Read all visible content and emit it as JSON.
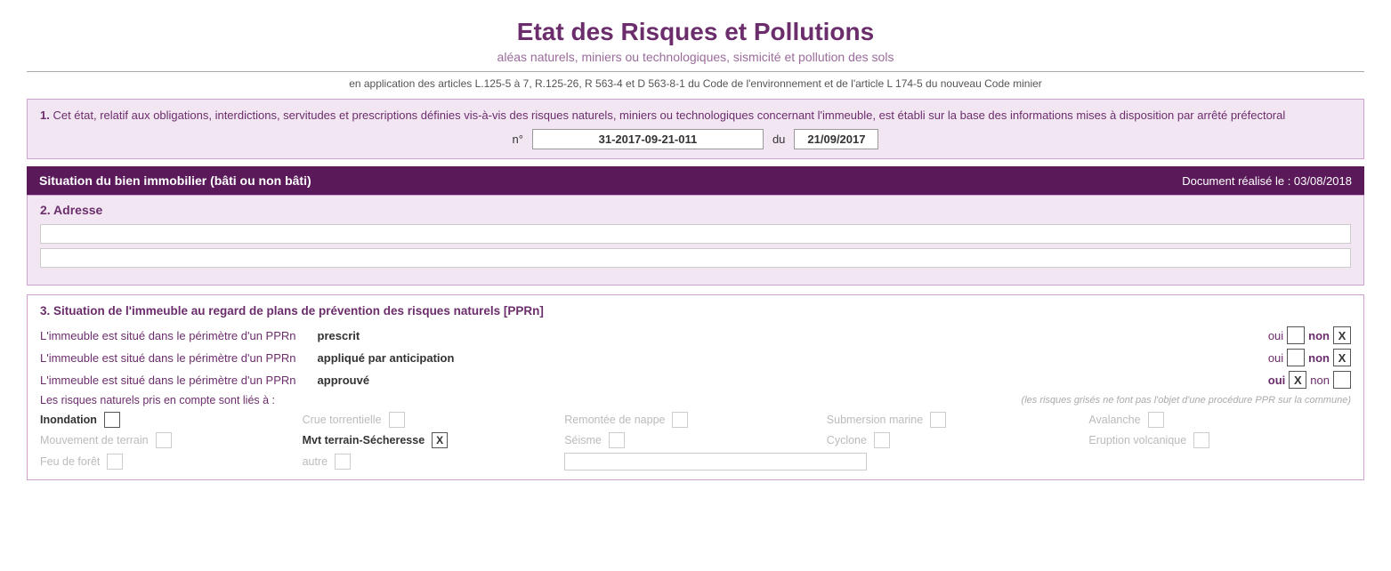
{
  "header": {
    "title": "Etat des Risques et Pollutions",
    "subtitle": "aléas naturels, miniers ou technologiques, sismicité et pollution des sols",
    "legal": "en application des articles L.125-5 à 7, R.125-26, R 563-4 et D 563-8-1 du Code de l'environnement et de l'article L 174-5 du nouveau Code minier"
  },
  "section1": {
    "label": "1.",
    "text": "Cet état, relatif aux obligations, interdictions, servitudes et prescriptions définies vis-à-vis des risques naturels, miniers ou technologiques concernant l'immeuble, est établi sur la base des informations mises à disposition par arrêté préfectoral",
    "numero_label": "n°",
    "numero_value": "31-2017-09-21-011",
    "du_label": "du",
    "date_value": "21/09/2017"
  },
  "situation_header": {
    "title": "Situation du bien immobilier (bâti ou non bâti)",
    "document_date_label": "Document réalisé le : 03/08/2018"
  },
  "section2": {
    "label": "2. Adresse"
  },
  "section3": {
    "title": "3. Situation de l'immeuble au regard de plans de prévention des risques naturels [PPRn]",
    "rows": [
      {
        "label": "L'immeuble est situé dans le périmètre d'un PPRn",
        "type": "prescrit",
        "oui": "",
        "non": "X"
      },
      {
        "label": "L'immeuble est situé dans le périmètre d'un PPRn",
        "type": "appliqué par anticipation",
        "oui": "",
        "non": "X"
      },
      {
        "label": "L'immeuble est situé dans le périmètre d'un PPRn",
        "type": "approuvé",
        "oui": "X",
        "non": ""
      }
    ],
    "risques_label": "Les risques naturels pris en compte sont liés à :",
    "risques_note": "(les risques grisés ne font pas l'objet d'une procédure PPR sur la commune)",
    "risques": [
      {
        "name": "Inondation",
        "checked": "",
        "greyed": false,
        "bold": false
      },
      {
        "name": "Crue torrentielle",
        "checked": "",
        "greyed": true,
        "bold": false
      },
      {
        "name": "Remontée de nappe",
        "checked": "",
        "greyed": true,
        "bold": false
      },
      {
        "name": "Submersion marine",
        "checked": "",
        "greyed": true,
        "bold": false
      },
      {
        "name": "Avalanche",
        "checked": "",
        "greyed": true,
        "bold": false
      },
      {
        "name": "Mouvement de terrain",
        "checked": "",
        "greyed": true,
        "bold": false
      },
      {
        "name": "Mvt terrain-Sécheresse",
        "checked": "X",
        "greyed": false,
        "bold": true
      },
      {
        "name": "Séisme",
        "checked": "",
        "greyed": true,
        "bold": false
      },
      {
        "name": "Cyclone",
        "checked": "",
        "greyed": true,
        "bold": false
      },
      {
        "name": "Eruption volcanique",
        "checked": "",
        "greyed": true,
        "bold": false
      },
      {
        "name": "Feu de forêt",
        "checked": "",
        "greyed": true,
        "bold": false
      },
      {
        "name": "autre",
        "checked": "",
        "greyed": true,
        "bold": false
      },
      {
        "name": "",
        "checked": "",
        "greyed": true,
        "bold": false,
        "is_text_box": true
      }
    ]
  }
}
